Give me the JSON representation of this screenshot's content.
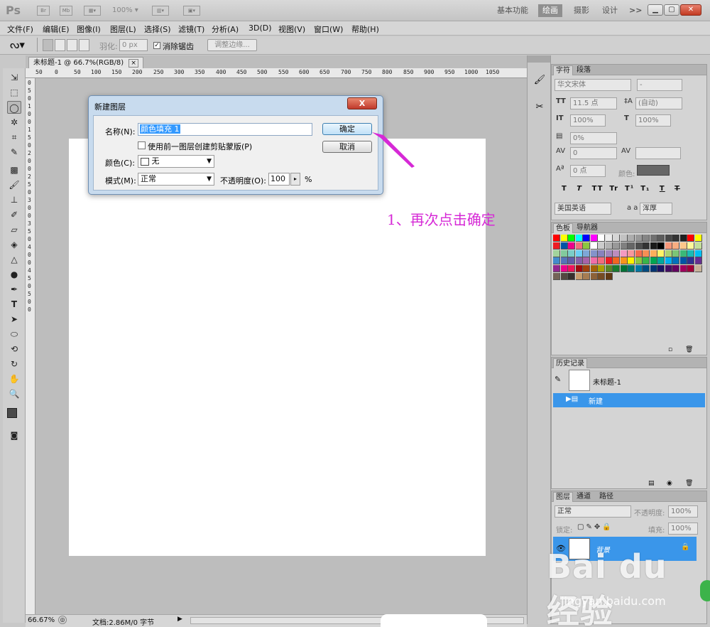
{
  "appbar": {
    "logo": "Ps",
    "zoom_value": "100%",
    "workspaces": [
      "基本功能",
      "绘画",
      "摄影",
      "设计"
    ],
    "workspace_active": "绘画",
    "more_label": ">>"
  },
  "menubar": {
    "items": [
      "文件(F)",
      "编辑(E)",
      "图像(I)",
      "图层(L)",
      "选择(S)",
      "滤镜(T)",
      "分析(A)",
      "3D(D)",
      "视图(V)",
      "窗口(W)",
      "帮助(H)"
    ]
  },
  "options": {
    "feather_label": "羽化:",
    "feather_value": "0 px",
    "antialias_label": "消除锯齿",
    "refine_edge_label": "调整边缘..."
  },
  "document": {
    "tab_title": "未标题-1 @ 66.7%(RGB/8)",
    "tab_close": "×"
  },
  "ruler": {
    "top_ticks": [
      "50",
      "0",
      "50",
      "100",
      "150",
      "200",
      "250",
      "300",
      "350",
      "400",
      "450",
      "500",
      "550",
      "600",
      "650",
      "700",
      "750",
      "800",
      "850",
      "900",
      "950",
      "1000",
      "1050"
    ],
    "left_ticks": [
      "0",
      "5",
      "0",
      "1",
      "0",
      "0",
      "1",
      "5",
      "0",
      "2",
      "0",
      "0",
      "2",
      "5",
      "0",
      "3",
      "0",
      "0",
      "3",
      "5",
      "0",
      "4",
      "0",
      "0",
      "4",
      "5",
      "0",
      "5",
      "0",
      "0"
    ]
  },
  "status": {
    "zoom": "66.67%",
    "doc_info": "文档:2.86M/0 字节"
  },
  "dialog": {
    "title": "新建图层",
    "close_label": "X",
    "name_label": "名称(N):",
    "name_value": "颜色填充 1",
    "clip_label": "使用前一图层创建剪贴蒙版(P)",
    "color_label": "颜色(C):",
    "color_value": "无",
    "mode_label": "模式(M):",
    "mode_value": "正常",
    "opacity_label": "不透明度(O):",
    "opacity_value": "100",
    "opacity_unit": "%",
    "ok_label": "确定",
    "cancel_label": "取消"
  },
  "annotation": {
    "text": "1、再次点击确定",
    "color": "#d629d6"
  },
  "char_panel": {
    "tabs": [
      "字符",
      "段落"
    ],
    "font_family": "华文宋体",
    "font_style": "-",
    "font_size": "11.5 点",
    "leading": "(自动)",
    "vscale": "100%",
    "hscale": "100%",
    "baseline_shift": "0%",
    "tracking": "0",
    "kerning_value": "0 点",
    "color_label": "颜色:",
    "type_buttons": [
      "T",
      "T",
      "TT",
      "Tr",
      "T¹",
      "T₁",
      "T",
      "T"
    ],
    "language": "美国英语",
    "aa_label": "a a",
    "aa_value": "浑厚"
  },
  "swatch_panel": {
    "tabs": [
      "色板",
      "导航器"
    ]
  },
  "history_panel": {
    "title": "历史记录",
    "snapshot_label": "未标题-1",
    "step_label": "新建"
  },
  "layers_panel": {
    "tabs": [
      "图层",
      "通道",
      "路径"
    ],
    "blend_mode": "正常",
    "opacity_label": "不透明度:",
    "opacity_value": "100%",
    "lock_label": "锁定:",
    "fill_label": "填充:",
    "fill_value": "100%",
    "layer_name": "背景"
  },
  "watermark": {
    "brand": "Bai du 经验",
    "url": "jingyan.baidu.com"
  },
  "colors": {
    "accent_blue": "#3399ff",
    "selected_blue": "#3a96ea",
    "annotation_magenta": "#d629d6"
  }
}
